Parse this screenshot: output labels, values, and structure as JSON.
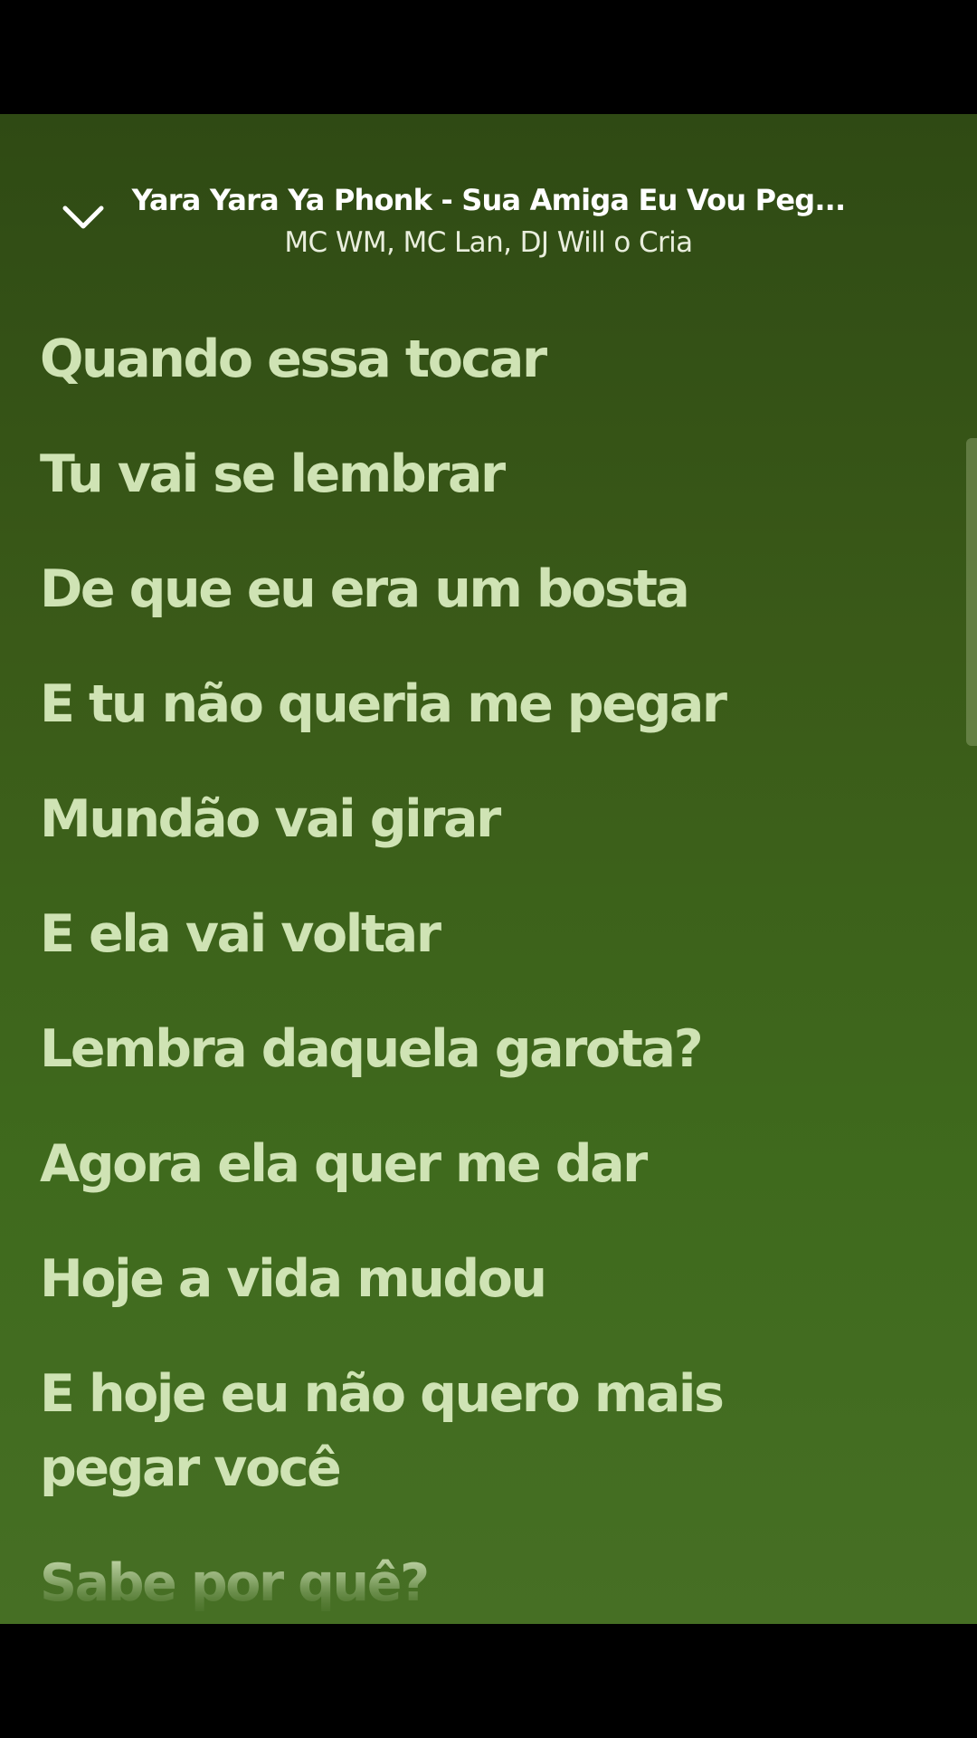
{
  "header": {
    "track_title": "Yara Yara Ya Phonk - Sua Amiga Eu Vou Peg...",
    "artists": "MC WM, MC Lan, DJ Will o Cria",
    "collapse_icon": "chevron-down-icon"
  },
  "lyrics": [
    "Quando essa tocar",
    "Tu vai se lembrar",
    "De que eu era um bosta",
    "E tu não queria me pegar",
    "Mundão vai girar",
    "E ela vai voltar",
    "Lembra daquela garota?",
    "Agora ela quer me dar",
    "Hoje a vida mudou",
    "E hoje eu não quero mais pegar você",
    "Sabe por quê?"
  ],
  "colors": {
    "background_top": "#2f4a14",
    "background_bottom": "#466f24",
    "lyric_text": "#cfe3b4",
    "title_text": "#ffffff"
  }
}
